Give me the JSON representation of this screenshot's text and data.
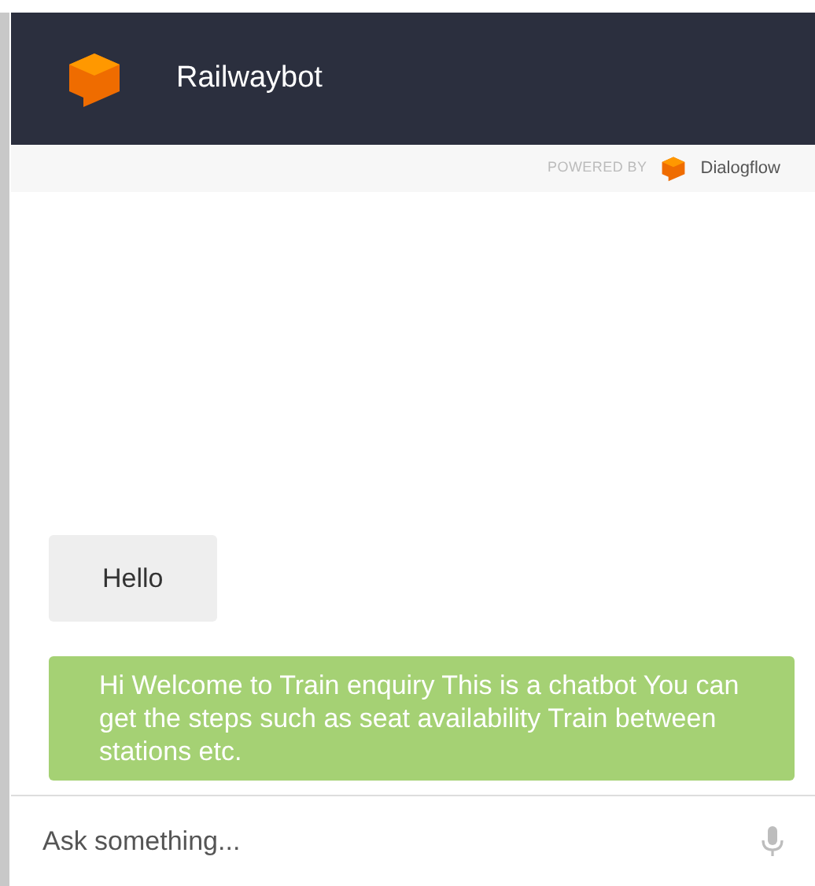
{
  "header": {
    "title": "Railwaybot"
  },
  "powered_by": {
    "label": "POWERED BY",
    "brand": "Dialogflow"
  },
  "messages": [
    {
      "kind": "user",
      "text": "Hello"
    },
    {
      "kind": "bot",
      "text": "Hi Welcome to Train enquiry This is a chatbot You can get the steps such as seat availability Train between stations etc."
    }
  ],
  "input": {
    "placeholder": "Ask something..."
  }
}
